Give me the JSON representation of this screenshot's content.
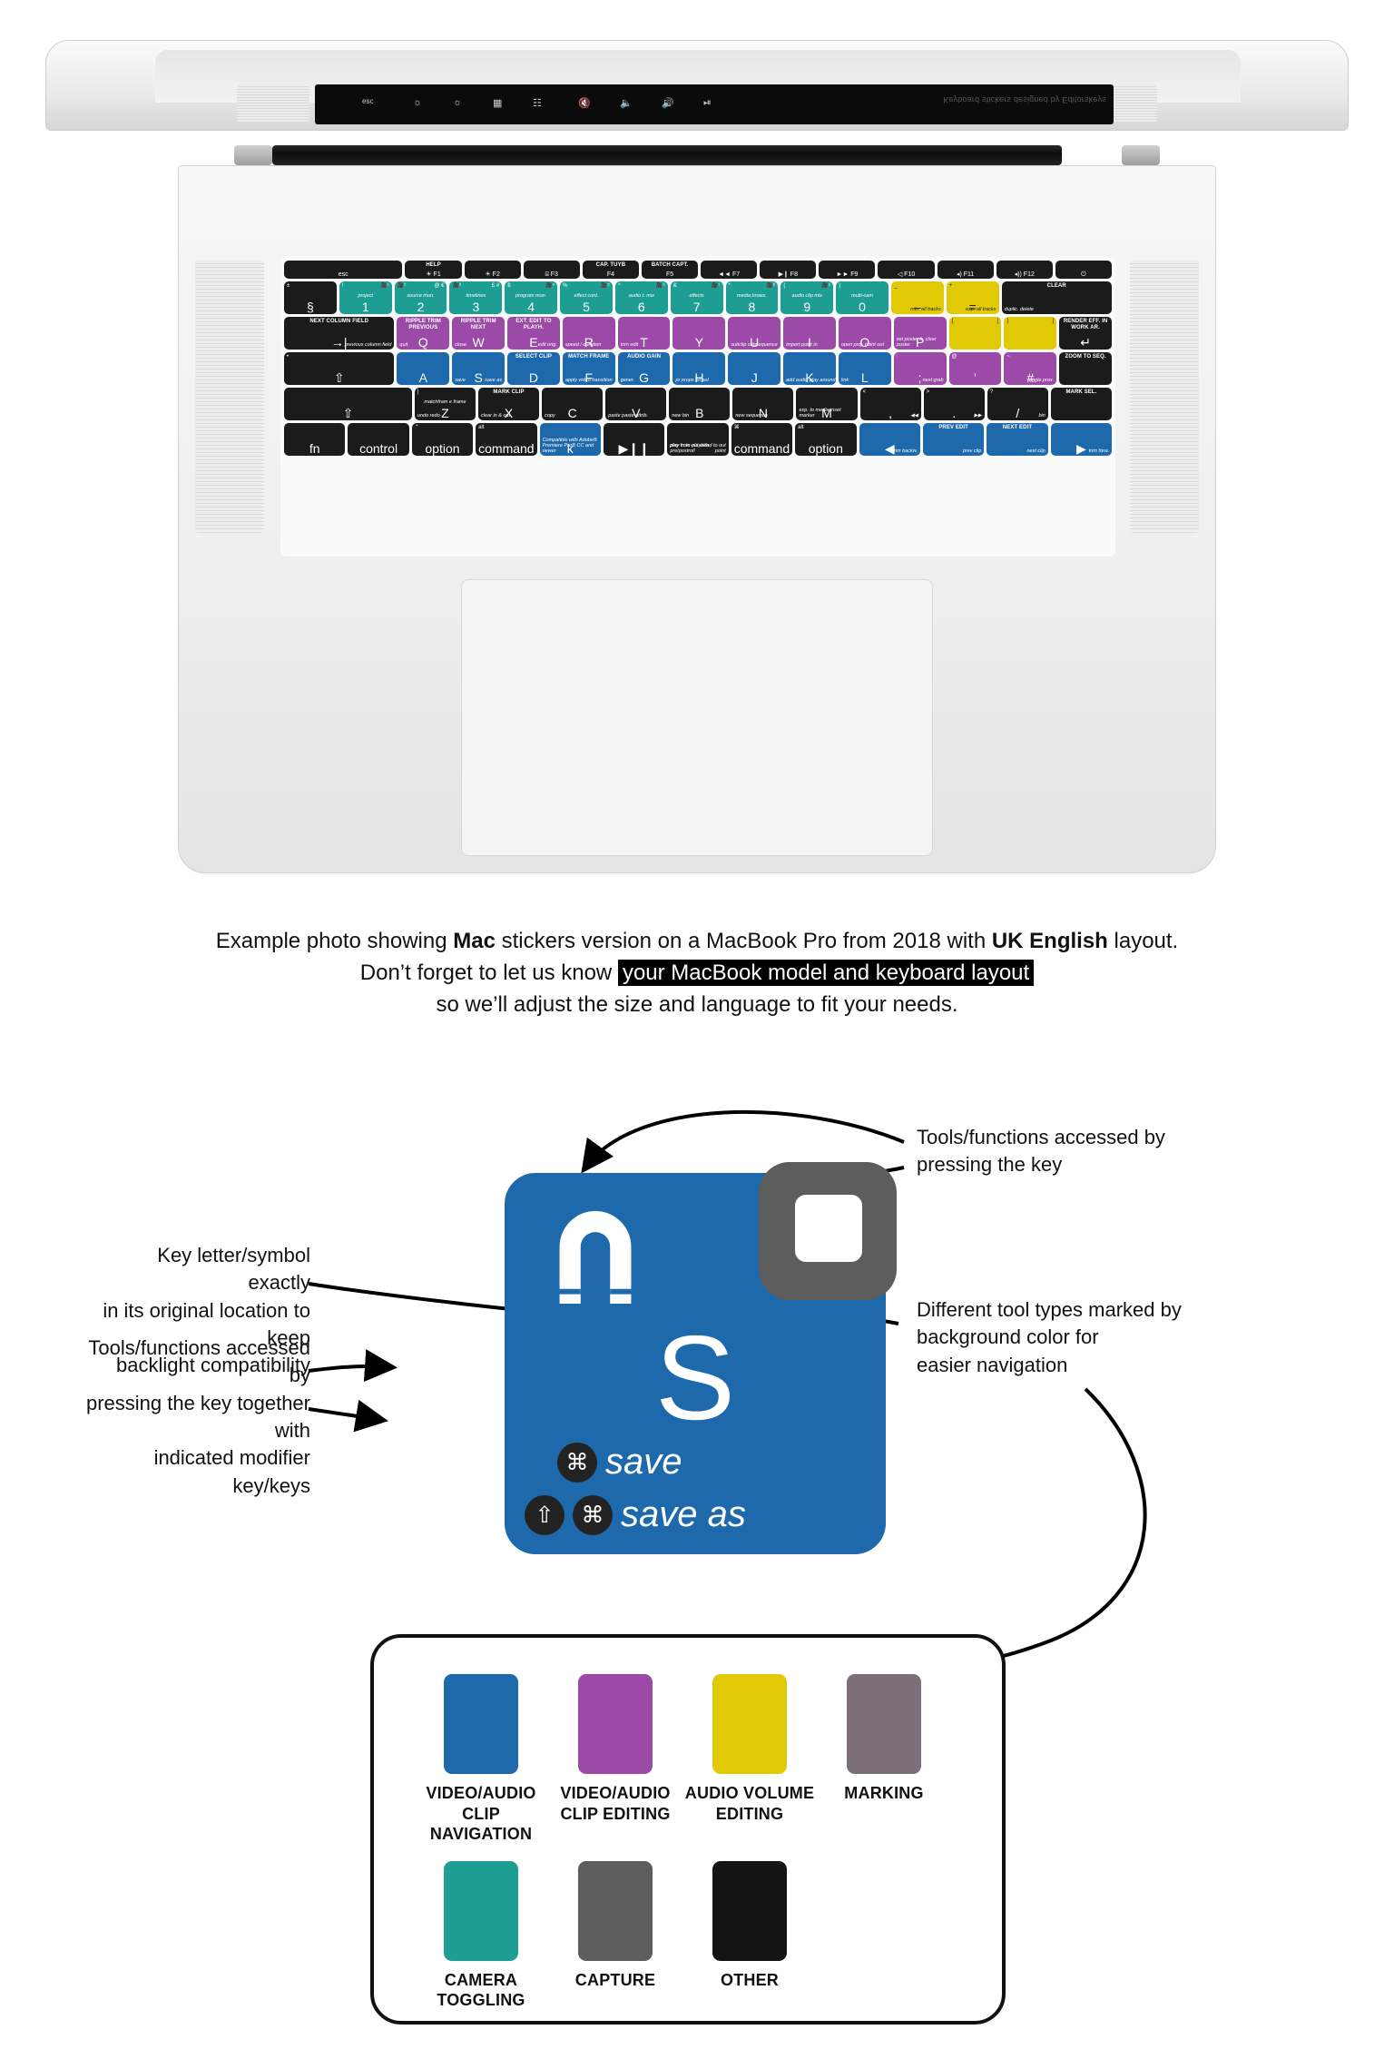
{
  "photo": {
    "screen_reflection_text": "Keyboard stickers designed by Editorskeys",
    "touchbar_icons": [
      "esc",
      "brightness-down-icon",
      "brightness-up-icon",
      "launchpad-icon",
      "keyboard-light-icon",
      "mute-icon",
      "volume-down-icon",
      "volume-up-icon",
      "play-pause-icon"
    ],
    "function_row": [
      {
        "label": "esc",
        "wide": true,
        "color": "dark"
      },
      {
        "cap": "HELP",
        "glyph": "☀",
        "label": "F1",
        "color": "dark"
      },
      {
        "glyph": "☀",
        "label": "F2",
        "color": "dark"
      },
      {
        "glyph": "⌸",
        "label": "F3",
        "color": "dark"
      },
      {
        "cap": "CAP. TUYB",
        "label": "F4",
        "color": "dark"
      },
      {
        "cap": "BATCH CAPT.",
        "label": "F5",
        "color": "dark"
      },
      {
        "glyph": "◄◄",
        "label": "F7",
        "color": "dark"
      },
      {
        "glyph": "▶❙",
        "label": "F8",
        "color": "dark"
      },
      {
        "glyph": "►►",
        "label": "F9",
        "color": "dark"
      },
      {
        "glyph": "◁",
        "label": "F10",
        "color": "dark"
      },
      {
        "glyph": "◂)",
        "label": "F11",
        "color": "dark"
      },
      {
        "glyph": "◂))",
        "label": "F12",
        "color": "dark"
      },
      {
        "glyph": "⏻",
        "label": "",
        "color": "dark"
      }
    ],
    "number_row": [
      {
        "tl": "±",
        "lg": "§",
        "color": "dark"
      },
      {
        "tl": "!",
        "tr": "🎥¹",
        "mid": "project",
        "lg": "1",
        "color": "teal"
      },
      {
        "tl": "🎥²",
        "tr": "@ €",
        "mid": "source mon.",
        "lg": "2",
        "color": "teal"
      },
      {
        "tl": "🎥³",
        "tr": "£ #",
        "mid": "timelines",
        "lg": "3",
        "color": "teal"
      },
      {
        "tl": "$",
        "tr": "🎥⁴",
        "mid": "program mon.",
        "lg": "4",
        "color": "teal"
      },
      {
        "tl": "%",
        "tr": "🎥⁵",
        "mid": "effect cont.",
        "lg": "5",
        "color": "teal"
      },
      {
        "tl": "^",
        "tr": "🎥⁶",
        "mid": "audio t. mix",
        "lg": "6",
        "color": "teal"
      },
      {
        "tl": "&",
        "tr": "🎥⁷",
        "mid": "effects",
        "lg": "7",
        "color": "teal"
      },
      {
        "tl": "*",
        "tr": "🎥⁸",
        "mid": "media brows.",
        "lg": "8",
        "color": "teal"
      },
      {
        "tl": "(",
        "tr": "🎥⁹",
        "mid": "audio clip mix",
        "lg": "9",
        "color": "teal"
      },
      {
        "tl": ")",
        "mid": "multi-cam",
        "lg": "0",
        "color": "teal"
      },
      {
        "tl": "_",
        "br": "min. all tracks",
        "lg": "–",
        "color": "yellow"
      },
      {
        "tl": "+",
        "br": "exp. all tracks",
        "lg": "=",
        "color": "yellow"
      },
      {
        "cap": "CLEAR",
        "bl": "duplic. delete",
        "color": "dark",
        "wide": true
      }
    ],
    "qwerty_row": [
      {
        "cap": "NEXT COLUMN FIELD",
        "br": "previous column field",
        "lg": "→|",
        "color": "dark",
        "wide": true
      },
      {
        "cap": "RIPPLE TRIM PREVIOUS",
        "lg": "Q",
        "bl": "quit",
        "color": "purple"
      },
      {
        "cap": "RIPPLE TRIM NEXT",
        "lg": "W",
        "bl": "close",
        "color": "purple"
      },
      {
        "cap": "EXT. EDIT TO PLAYH.",
        "lg": "E",
        "br": "edit orig.",
        "color": "purple"
      },
      {
        "lg": "R",
        "bl": "speed / duration",
        "color": "purple"
      },
      {
        "lg": "T",
        "bl": "trim edit",
        "color": "purple"
      },
      {
        "lg": "Y",
        "color": "purple"
      },
      {
        "lg": "U",
        "bl": "subclip subsequence",
        "color": "purple"
      },
      {
        "lg": "I",
        "bl": "import point in",
        "color": "purple"
      },
      {
        "lg": "O",
        "bl": "open proj. point out",
        "color": "purple"
      },
      {
        "lg": "P",
        "bl": "set poster fr. clear poster",
        "color": "purple"
      },
      {
        "tl": "{",
        "tr": "[",
        "lg": "",
        "color": "yellow"
      },
      {
        "tl": "}",
        "tr": "]",
        "lg": "",
        "color": "yellow"
      },
      {
        "cap": "RENDER EFF. IN WORK AR.",
        "lg": "↵",
        "color": "dark"
      }
    ],
    "asdf_row": [
      {
        "tl": "•",
        "lg": "⇧",
        "color": "dark",
        "wide": true
      },
      {
        "lg": "A",
        "color": "blue"
      },
      {
        "lg": "S",
        "bl": "save",
        "br": "save as",
        "color": "blue"
      },
      {
        "cap": "SELECT CLIP",
        "lg": "D",
        "color": "blue"
      },
      {
        "cap": "MATCH FRAME",
        "lg": "F",
        "bl": "apply video transition",
        "color": "blue"
      },
      {
        "cap": "AUDIO GAIN",
        "lg": "G",
        "bl": "gener.",
        "color": "blue"
      },
      {
        "lg": "H",
        "bl": "pr props fst sel.",
        "color": "blue"
      },
      {
        "lg": "J",
        "color": "blue"
      },
      {
        "lg": "K",
        "bl": "add audio play around",
        "color": "blue"
      },
      {
        "lg": "L",
        "bl": "link",
        "color": "blue"
      },
      {
        "tl": ":",
        "lg": ";",
        "br": "next grab",
        "color": "purple"
      },
      {
        "tl": "@",
        "lg": "'",
        "color": "purple"
      },
      {
        "tl": "~",
        "lg": "#",
        "br": "toggle prox.",
        "color": "purple"
      },
      {
        "cap": "ZOOM TO SEQ.",
        "color": "dark"
      }
    ],
    "zxcv_row": [
      {
        "lg": "⇧",
        "color": "dark",
        "wide": true
      },
      {
        "lg": "Z",
        "tl": "|",
        "bl": "undo redo",
        "mid": "matchfram e frame",
        "color": "dark"
      },
      {
        "cap": "MARK CLIP",
        "lg": "X",
        "bl": "clear in & out",
        "color": "dark"
      },
      {
        "lg": "C",
        "bl": "copy",
        "color": "dark"
      },
      {
        "lg": "V",
        "bl": "paste paste attrib.",
        "color": "dark"
      },
      {
        "lg": "B",
        "bl": "new bin",
        "color": "dark"
      },
      {
        "lg": "N",
        "bl": "new sequence",
        "color": "dark"
      },
      {
        "lg": "M",
        "bl": "exp. to media inset marker",
        "color": "dark"
      },
      {
        "tl": "<",
        "lg": ",",
        "br": "◀◀",
        "color": "dark"
      },
      {
        "tl": ">",
        "lg": ".",
        "br": "▶▶",
        "color": "dark"
      },
      {
        "tl": "?",
        "lg": "/",
        "br": "bin",
        "color": "dark"
      },
      {
        "cap": "MARK SEL.",
        "color": "dark"
      }
    ],
    "bottom_row": [
      {
        "lg": "fn",
        "color": "dark"
      },
      {
        "lg": "control",
        "color": "dark"
      },
      {
        "tl": "⌃",
        "lg": "option",
        "color": "dark"
      },
      {
        "tl": "alt",
        "lg": "command",
        "color": "dark"
      },
      {
        "lg": "k",
        "bl": "Compatible with Adobe® Premiere Pro® CC and newer",
        "color": "blue"
      },
      {
        "lg": "▶❙❙",
        "color": "dark"
      },
      {
        "bl": "play in to out with pre/postroll",
        "br": "play from playhead to out point",
        "color": "dark"
      },
      {
        "tl": "⌘",
        "lg": "command",
        "color": "dark"
      },
      {
        "tl": "alt",
        "lg": "option",
        "color": "dark"
      },
      {
        "lg": "◀",
        "br": "trim backw.",
        "color": "blue"
      },
      {
        "cap": "PREV EDIT",
        "br": "prev clip",
        "color": "blue"
      },
      {
        "cap": "NEXT EDIT",
        "br": "next clip",
        "color": "blue"
      },
      {
        "lg": "▶",
        "br": "trim forw.",
        "color": "blue"
      }
    ]
  },
  "caption": {
    "line1_a": "Example photo showing ",
    "line1_bold1": "Mac",
    "line1_b": " stickers version on a MacBook Pro from 2018 with ",
    "line1_bold2": "UK English",
    "line1_c": " layout.",
    "line2_a": "Don’t forget to let us know",
    "line2_highlight": "your MacBook model and keyboard layout",
    "line3": "so we’ll adjust the size and language to fit your needs."
  },
  "diagram": {
    "key": {
      "background_color": "#1d69ab",
      "badge_color": "#5d5d5d",
      "letter": "S",
      "tool_icon_name": "magnet-icon",
      "badge_icon_name": "white-rounded-square-icon",
      "shortcuts": [
        {
          "mods": [
            "⌘"
          ],
          "label": "save"
        },
        {
          "mods": [
            "⇧",
            "⌘"
          ],
          "label": "save as"
        }
      ]
    },
    "annotations": {
      "top_right": "Tools/functions accessed by\npressing the key",
      "left_upper": "Key letter/symbol exactly\nin its original location to keep\nbacklight compatibility",
      "left_lower": "Tools/functions accessed by\npressing the key together with\nindicated modifier key/keys",
      "right_lower": "Different tool types marked by\nbackground color for\neasier navigation"
    }
  },
  "legend": {
    "row1": [
      {
        "color": "#1d69ab",
        "label": "VIDEO/AUDIO\nCLIP NAVIGATION"
      },
      {
        "color": "#9b4aa8",
        "label": "VIDEO/AUDIO\nCLIP EDITING"
      },
      {
        "color": "#e2c906",
        "label": "AUDIO VOLUME\nEDITING"
      },
      {
        "color": "#7d6f78",
        "label": "MARKING"
      }
    ],
    "row2": [
      {
        "color": "#1e9e92",
        "label": "CAMERA\nTOGGLING"
      },
      {
        "color": "#5d5d5d",
        "label": "CAPTURE"
      },
      {
        "color": "#141414",
        "label": "OTHER"
      }
    ]
  }
}
